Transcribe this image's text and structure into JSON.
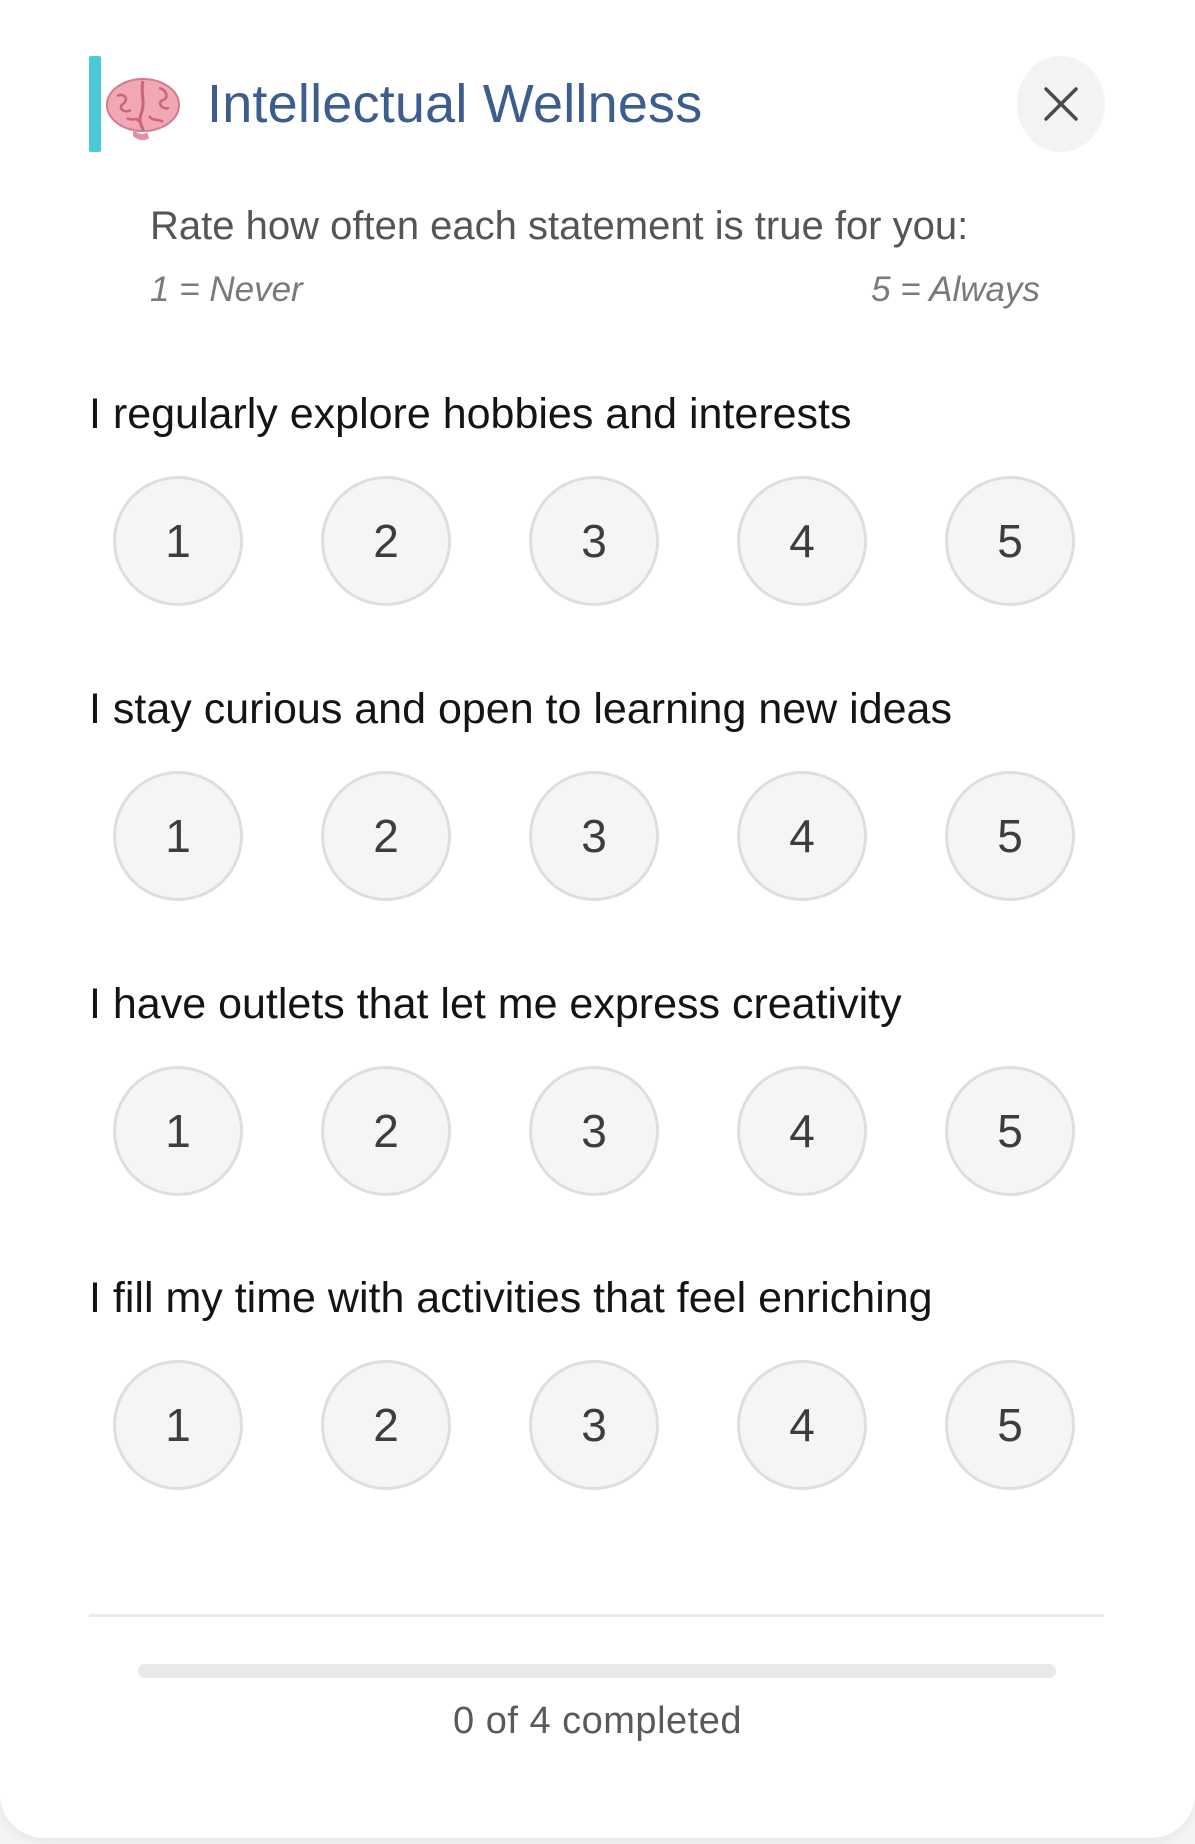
{
  "header": {
    "title": "Intellectual Wellness",
    "icon": "brain-icon",
    "close_icon": "close-icon"
  },
  "instructions": {
    "text": "Rate how often each statement is true for you:",
    "scale_min": "1 = Never",
    "scale_max": "5 = Always"
  },
  "questions": [
    {
      "text": "I regularly explore hobbies and interests",
      "options": [
        "1",
        "2",
        "3",
        "4",
        "5"
      ],
      "selected": null
    },
    {
      "text": "I stay curious and open to learning new ideas",
      "options": [
        "1",
        "2",
        "3",
        "4",
        "5"
      ],
      "selected": null
    },
    {
      "text": "I have outlets that let me express creativity",
      "options": [
        "1",
        "2",
        "3",
        "4",
        "5"
      ],
      "selected": null
    },
    {
      "text": "I fill my time with activities that feel enriching",
      "options": [
        "1",
        "2",
        "3",
        "4",
        "5"
      ],
      "selected": null
    }
  ],
  "progress": {
    "text": "0 of 4 completed",
    "fraction": 0
  },
  "colors": {
    "accent": "#4cc9d6",
    "title": "#3d5d8f",
    "progress_fill": "#4cc9d6"
  }
}
